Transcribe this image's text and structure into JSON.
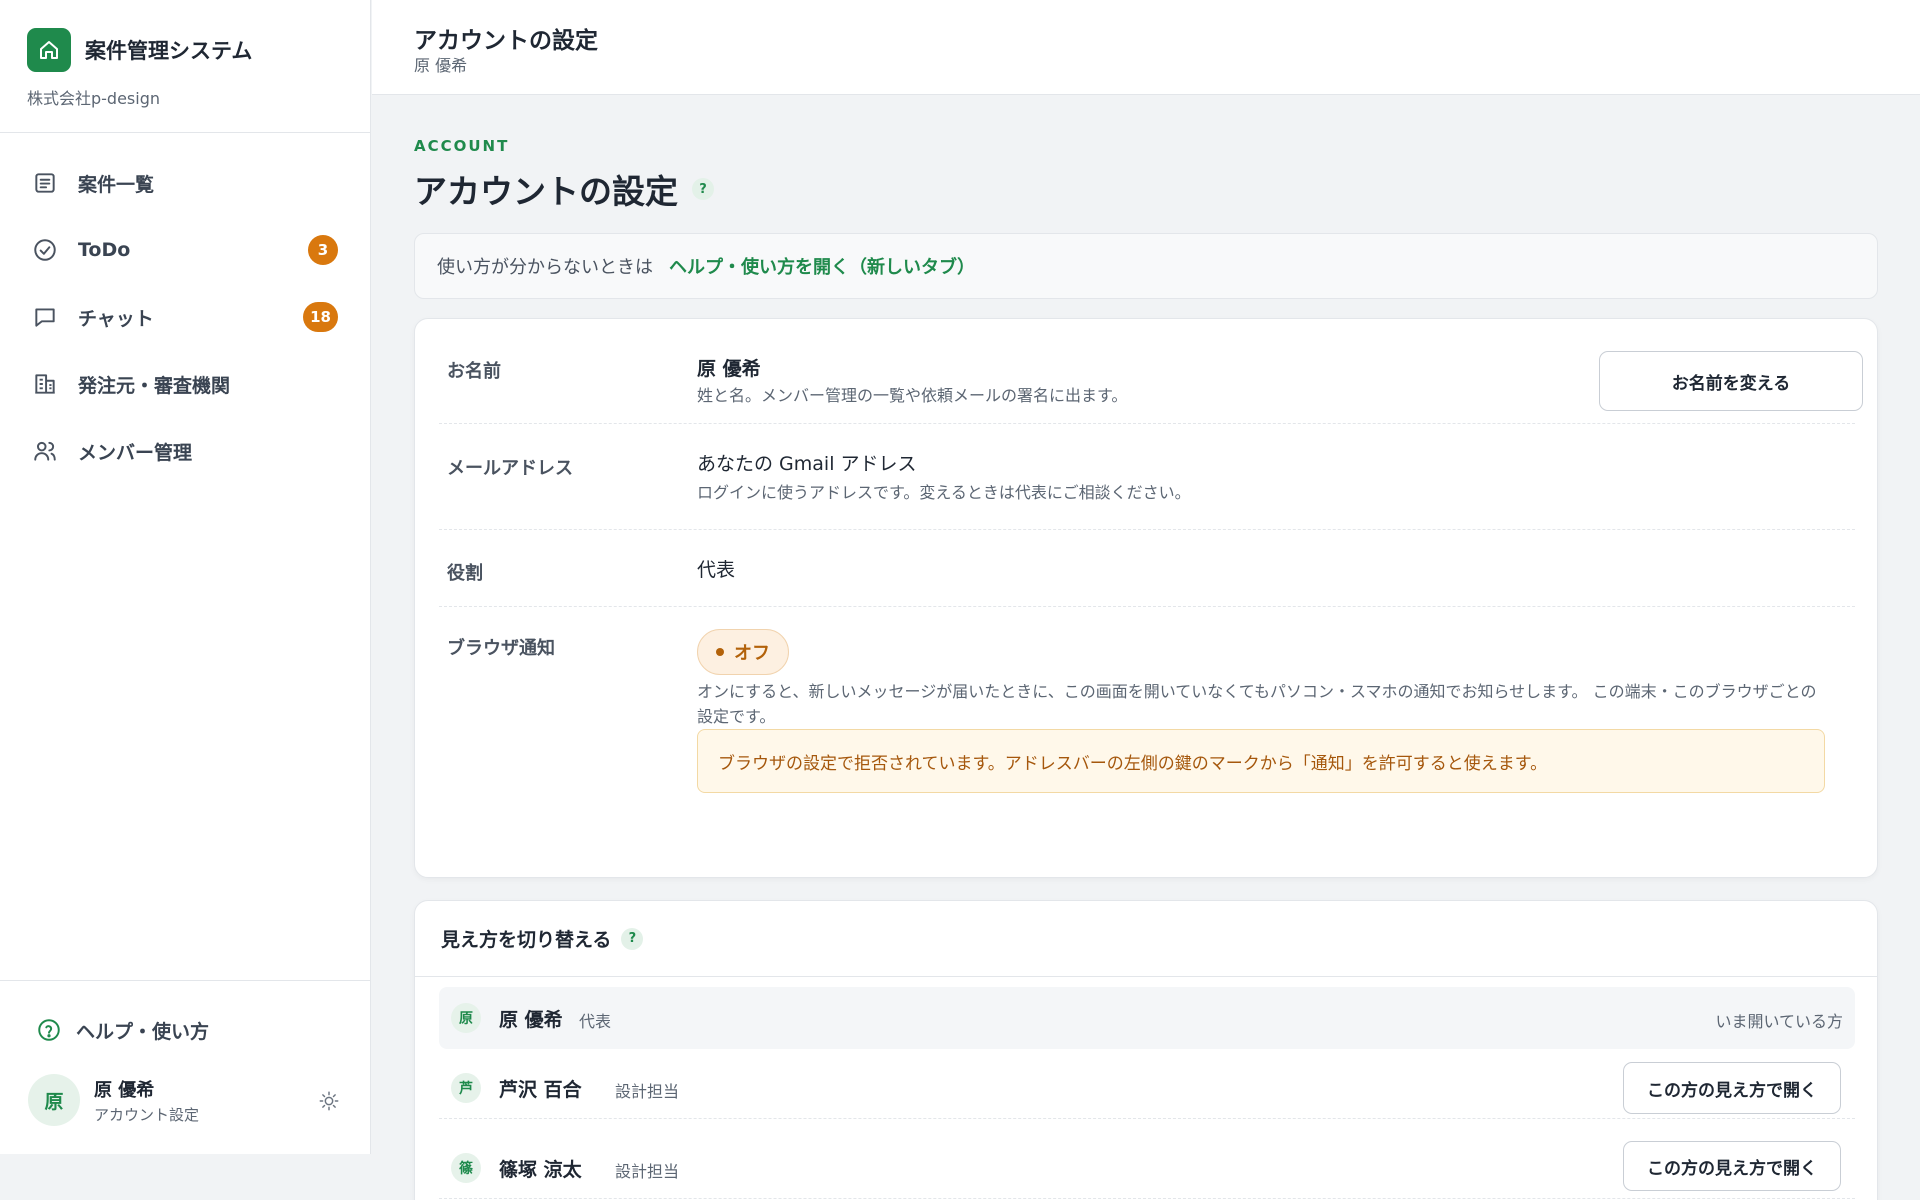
{
  "sidebar": {
    "app_title": "案件管理システム",
    "company": "株式会社p-design",
    "nav": [
      {
        "label": "案件一覧",
        "icon": "list-icon"
      },
      {
        "label": "ToDo",
        "icon": "check-circle-icon",
        "badge": "3"
      },
      {
        "label": "チャット",
        "icon": "chat-bubble-icon",
        "badge": "18"
      },
      {
        "label": "発注元・審査機関",
        "icon": "building-icon"
      },
      {
        "label": "メンバー管理",
        "icon": "users-icon"
      }
    ],
    "help_label": "ヘルプ・使い方",
    "user": {
      "avatar": "原",
      "name": "原 優希",
      "sub": "アカウント設定"
    }
  },
  "header": {
    "title": "アカウントの設定",
    "subtitle": "原 優希"
  },
  "main": {
    "eyebrow": "ACCOUNT",
    "title": "アカウントの設定",
    "help_mark": "?",
    "help_banner": {
      "text": "使い方が分からないときは",
      "link": "ヘルプ・使い方を開く（新しいタブ）"
    },
    "account": {
      "name": {
        "label": "お名前",
        "value": "原 優希",
        "desc": "姓と名。メンバー管理の一覧や依頼メールの署名に出ます。",
        "button": "お名前を変える"
      },
      "email": {
        "label": "メールアドレス",
        "value": "あなたの Gmail アドレス",
        "desc": "ログインに使うアドレスです。変えるときは代表にご相談ください。"
      },
      "role": {
        "label": "役割",
        "value": "代表"
      },
      "notify": {
        "label": "ブラウザ通知",
        "status": "オフ",
        "desc": "オンにすると、新しいメッセージが届いたときに、この画面を開いていなくてもパソコン・スマホの通知でお知らせします。 この端末・このブラウザごとの設定です。",
        "warning": "ブラウザの設定で拒否されています。アドレスバーの左側の鍵のマークから「通知」を許可すると使えます。"
      }
    },
    "switch_view": {
      "title": "見え方を切り替える",
      "members": [
        {
          "avatar": "原",
          "name": "原 優希",
          "role": "代表",
          "current_label": "いま開いている方"
        },
        {
          "avatar": "芦",
          "name": "芦沢 百合",
          "role": "設計担当",
          "button": "この方の見え方で開く"
        },
        {
          "avatar": "篠",
          "name": "篠塚 涼太",
          "role": "設計担当",
          "button": "この方の見え方で開く"
        }
      ]
    }
  },
  "colors": {
    "accent": "#1f8a4c",
    "badge": "#d9780e",
    "warning_text": "#a5570c"
  }
}
